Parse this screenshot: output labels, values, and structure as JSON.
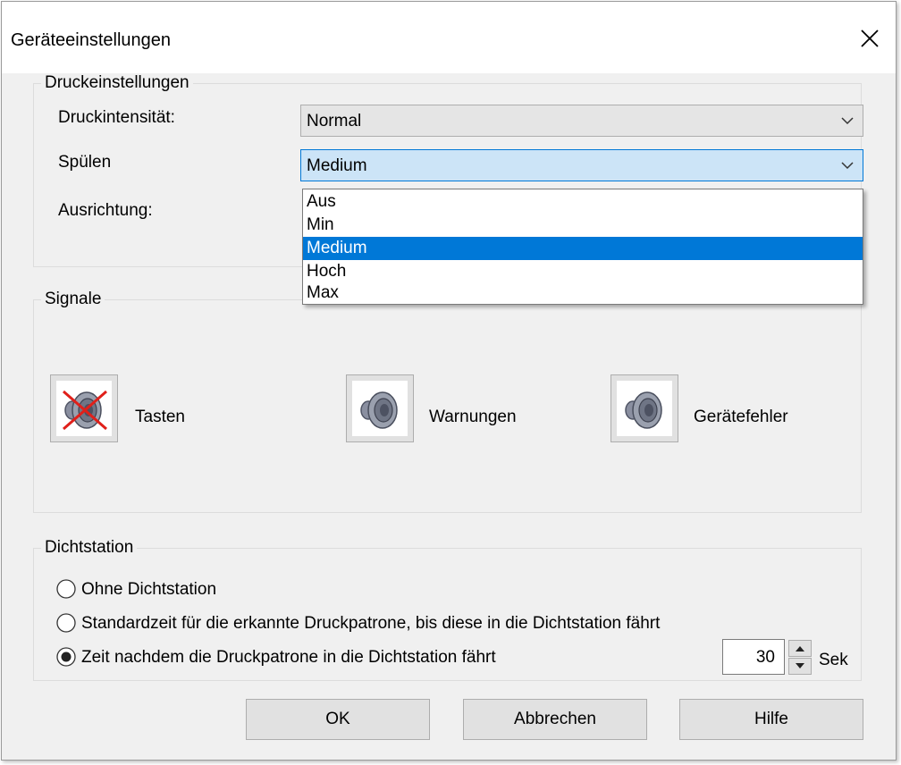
{
  "window": {
    "title": "Geräteeinstellungen",
    "close_icon": "close-icon"
  },
  "druck": {
    "legend": "Druckeinstellungen",
    "intensity_label": "Druckintensität:",
    "intensity_value": "Normal",
    "rinse_label": "Spülen",
    "rinse_value": "Medium",
    "orientation_label": "Ausrichtung:",
    "rinse_options": [
      "Aus",
      "Min",
      "Medium",
      "Hoch",
      "Max"
    ],
    "rinse_selected_index": 2
  },
  "signale": {
    "legend": "Signale",
    "items": [
      {
        "label": "Tasten",
        "icon": "speaker-muted-icon",
        "muted": true
      },
      {
        "label": "Warnungen",
        "icon": "speaker-icon",
        "muted": false
      },
      {
        "label": "Gerätefehler",
        "icon": "speaker-icon",
        "muted": false
      }
    ]
  },
  "dicht": {
    "legend": "Dichtstation",
    "options": [
      {
        "label": "Ohne Dichtstation",
        "checked": false
      },
      {
        "label": "Standardzeit für die erkannte Druckpatrone, bis diese in die Dichtstation fährt",
        "checked": false
      },
      {
        "label": "Zeit nachdem die Druckpatrone in die Dichtstation fährt",
        "checked": true
      }
    ],
    "seconds_value": "30",
    "seconds_unit": "Sek"
  },
  "buttons": {
    "ok": "OK",
    "cancel": "Abbrechen",
    "help": "Hilfe"
  },
  "colors": {
    "selection": "#0078d7",
    "combo_focus": "#cce4f7",
    "mute_cross": "#e0201a"
  }
}
